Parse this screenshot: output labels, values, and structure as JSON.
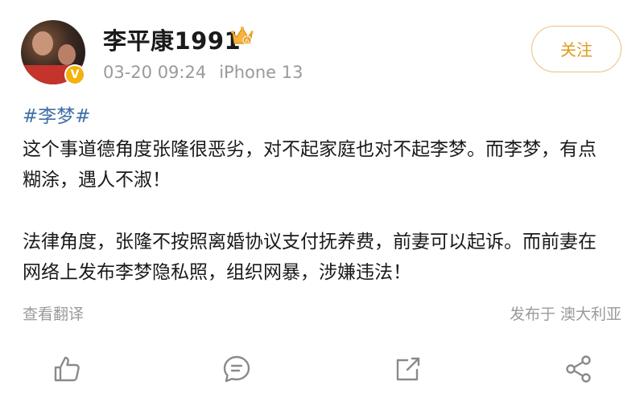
{
  "post": {
    "username": "李平康1991",
    "timestamp": "03-20 09:24",
    "device": "iPhone 13",
    "follow_label": "关注",
    "hashtag": "#李梦#",
    "paragraphs": [
      "这个事道德角度张隆很恶劣，对不起家庭也对不起李梦。而李梦，有点糊涂，遇人不淑！",
      "法律角度，张隆不按照离婚协议支付抚养费，前妻可以起诉。而前妻在网络上发布李梦隐私照，组织网暴，涉嫌违法！"
    ],
    "paragraph_lines": [
      [
        "这个事道德角度张隆很恶劣，对不起家庭也对不起李梦。而李梦，有点",
        "糊涂，遇人不淑！"
      ],
      [
        "法律角度，张隆不按照离婚协议支付抚养费，前妻可以起诉。而前妻在",
        "网络上发布李梦隐私照，组织网暴，涉嫌违法！"
      ]
    ],
    "translate_label": "查看翻译",
    "location_label": "发布于 澳大利亚"
  },
  "badges": {
    "verified_icon": "verified-v-icon",
    "member_icon": "crown-icon",
    "member_level": "6"
  },
  "actions": [
    {
      "name": "like-icon"
    },
    {
      "name": "comment-icon"
    },
    {
      "name": "share-icon"
    },
    {
      "name": "forward-icon"
    }
  ],
  "colors": {
    "accent": "#e29a1e",
    "hashtag": "#3f6fa5",
    "muted": "#9a9a9a",
    "verified": "#f3b20e"
  }
}
